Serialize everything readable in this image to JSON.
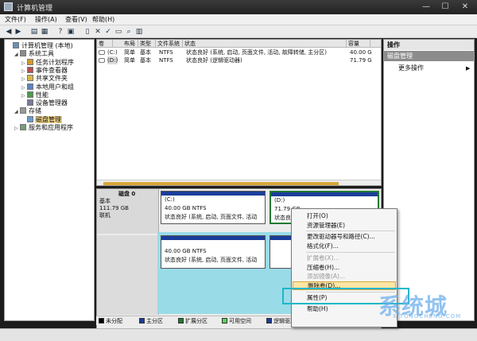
{
  "window": {
    "title": "计算机管理",
    "min": "—",
    "max": "☐",
    "close": "✕"
  },
  "menu": [
    "文件(F)",
    "操作(A)",
    "查看(V)",
    "帮助(H)"
  ],
  "toolbar": [
    {
      "icon": "back-arrow-icon",
      "glyph": "◀"
    },
    {
      "icon": "forward-arrow-icon",
      "glyph": "▶"
    },
    {
      "icon": "folder-icon",
      "glyph": "▤"
    },
    {
      "icon": "grid-icon",
      "glyph": "▦"
    },
    {
      "icon": "help-icon",
      "glyph": "?"
    },
    {
      "icon": "panel-icon",
      "glyph": "▣"
    },
    {
      "icon": "properties-icon",
      "glyph": "▯"
    },
    {
      "icon": "delete-icon",
      "glyph": "✕"
    },
    {
      "icon": "check-icon",
      "glyph": "✓"
    },
    {
      "icon": "open-folder-icon",
      "glyph": "▭"
    },
    {
      "icon": "search-icon",
      "glyph": "⌕"
    },
    {
      "icon": "list-icon",
      "glyph": "▥"
    }
  ],
  "tree": [
    {
      "name": "tree-item-computer-management",
      "label": "计算机管理 (本地)",
      "exp": "",
      "icon": "computer-icon",
      "depth": 0,
      "row": 0
    },
    {
      "name": "tree-item-system-tools",
      "label": "系统工具",
      "exp": "◢",
      "icon": "tools-icon",
      "depth": 1,
      "row": 1
    },
    {
      "name": "tree-item-task-scheduler",
      "label": "任务计划程序",
      "exp": "▷",
      "icon": "clock-icon",
      "depth": 2,
      "row": 2
    },
    {
      "name": "tree-item-event-viewer",
      "label": "事件查看器",
      "exp": "▷",
      "icon": "event-icon",
      "depth": 2,
      "row": 3
    },
    {
      "name": "tree-item-shared-folders",
      "label": "共享文件夹",
      "exp": "▷",
      "icon": "share-folder-icon",
      "depth": 2,
      "row": 4
    },
    {
      "name": "tree-item-local-users",
      "label": "本地用户和组",
      "exp": "▷",
      "icon": "users-icon",
      "depth": 2,
      "row": 5
    },
    {
      "name": "tree-item-performance",
      "label": "性能",
      "exp": "▷",
      "icon": "performance-icon",
      "depth": 2,
      "row": 6
    },
    {
      "name": "tree-item-device-manager",
      "label": "设备管理器",
      "exp": "",
      "icon": "device-icon",
      "depth": 2,
      "row": 7
    },
    {
      "name": "tree-item-storage",
      "label": "存储",
      "exp": "◢",
      "icon": "storage-icon",
      "depth": 1,
      "row": 8
    },
    {
      "name": "tree-item-disk-management",
      "label": "磁盘管理",
      "exp": "",
      "icon": "disk-icon",
      "depth": 2,
      "row": 9,
      "selected": true
    },
    {
      "name": "tree-item-services",
      "label": "服务和应用程序",
      "exp": "▷",
      "icon": "services-icon",
      "depth": 1,
      "row": 10
    }
  ],
  "volumes": {
    "columns": [
      "卷",
      "布局",
      "类型",
      "文件系统",
      "状态",
      "容量"
    ],
    "rows": [
      [
        "(C:)",
        "简单",
        "基本",
        "NTFS",
        "状态良好 (系统, 启动, 页面文件, 活动, 故障转储, 主分区)",
        "40.00 G"
      ],
      [
        "(D:)",
        "简单",
        "基本",
        "NTFS",
        "状态良好 (逻辑驱动器)",
        "71.79 G"
      ]
    ]
  },
  "disk0": {
    "title": "磁盘 0",
    "type": "基本",
    "size": "111.79 GB",
    "status": "联机",
    "part_c": {
      "name": "(C:)",
      "size": "40.00 GB NTFS",
      "status": "状态良好 (系统, 启动, 页面文件, 活动"
    },
    "part_d": {
      "name": "(D:)",
      "size": "71.79 GB",
      "status": "状态良好"
    }
  },
  "disk1": {
    "part": {
      "size": "40.00 GB NTFS",
      "status": "状态良好 (系统, 启动, 页面文件, 活动"
    }
  },
  "legend": [
    {
      "label": "未分配",
      "color": "#000000"
    },
    {
      "label": "主分区",
      "color": "#1b3d9a"
    },
    {
      "label": "扩展分区",
      "color": "#1f7a32"
    },
    {
      "label": "可用空间",
      "color": "#5cd25c"
    },
    {
      "label": "逻辑驱动器",
      "color": "#1b3d9a"
    }
  ],
  "actions": {
    "title": "操作",
    "subtitle": "磁盘管理",
    "more": "更多操作",
    "arrow": "▶"
  },
  "context_menu": [
    {
      "label": "打开(O)",
      "disabled": false
    },
    {
      "label": "资源管理器(E)",
      "disabled": false
    },
    {
      "sep": true
    },
    {
      "label": "更改驱动器号和路径(C)...",
      "disabled": false
    },
    {
      "label": "格式化(F)...",
      "disabled": false
    },
    {
      "sep": true
    },
    {
      "label": "扩展卷(X)...",
      "disabled": true
    },
    {
      "label": "压缩卷(H)...",
      "disabled": false
    },
    {
      "label": "添加镜像(A)...",
      "disabled": true
    },
    {
      "label": "删除卷(D)...",
      "disabled": false,
      "highlight": true
    },
    {
      "sep": true
    },
    {
      "label": "属性(P)",
      "disabled": false
    },
    {
      "sep": true
    },
    {
      "label": "帮助(H)",
      "disabled": false
    }
  ],
  "watermark": {
    "brand": "系统城",
    "url": "XITONGCHENG.COM"
  },
  "colors": {
    "selection": "#f1d58a",
    "highlight_border": "#1eb7c9",
    "partition_bar": "#1b3d9a"
  }
}
